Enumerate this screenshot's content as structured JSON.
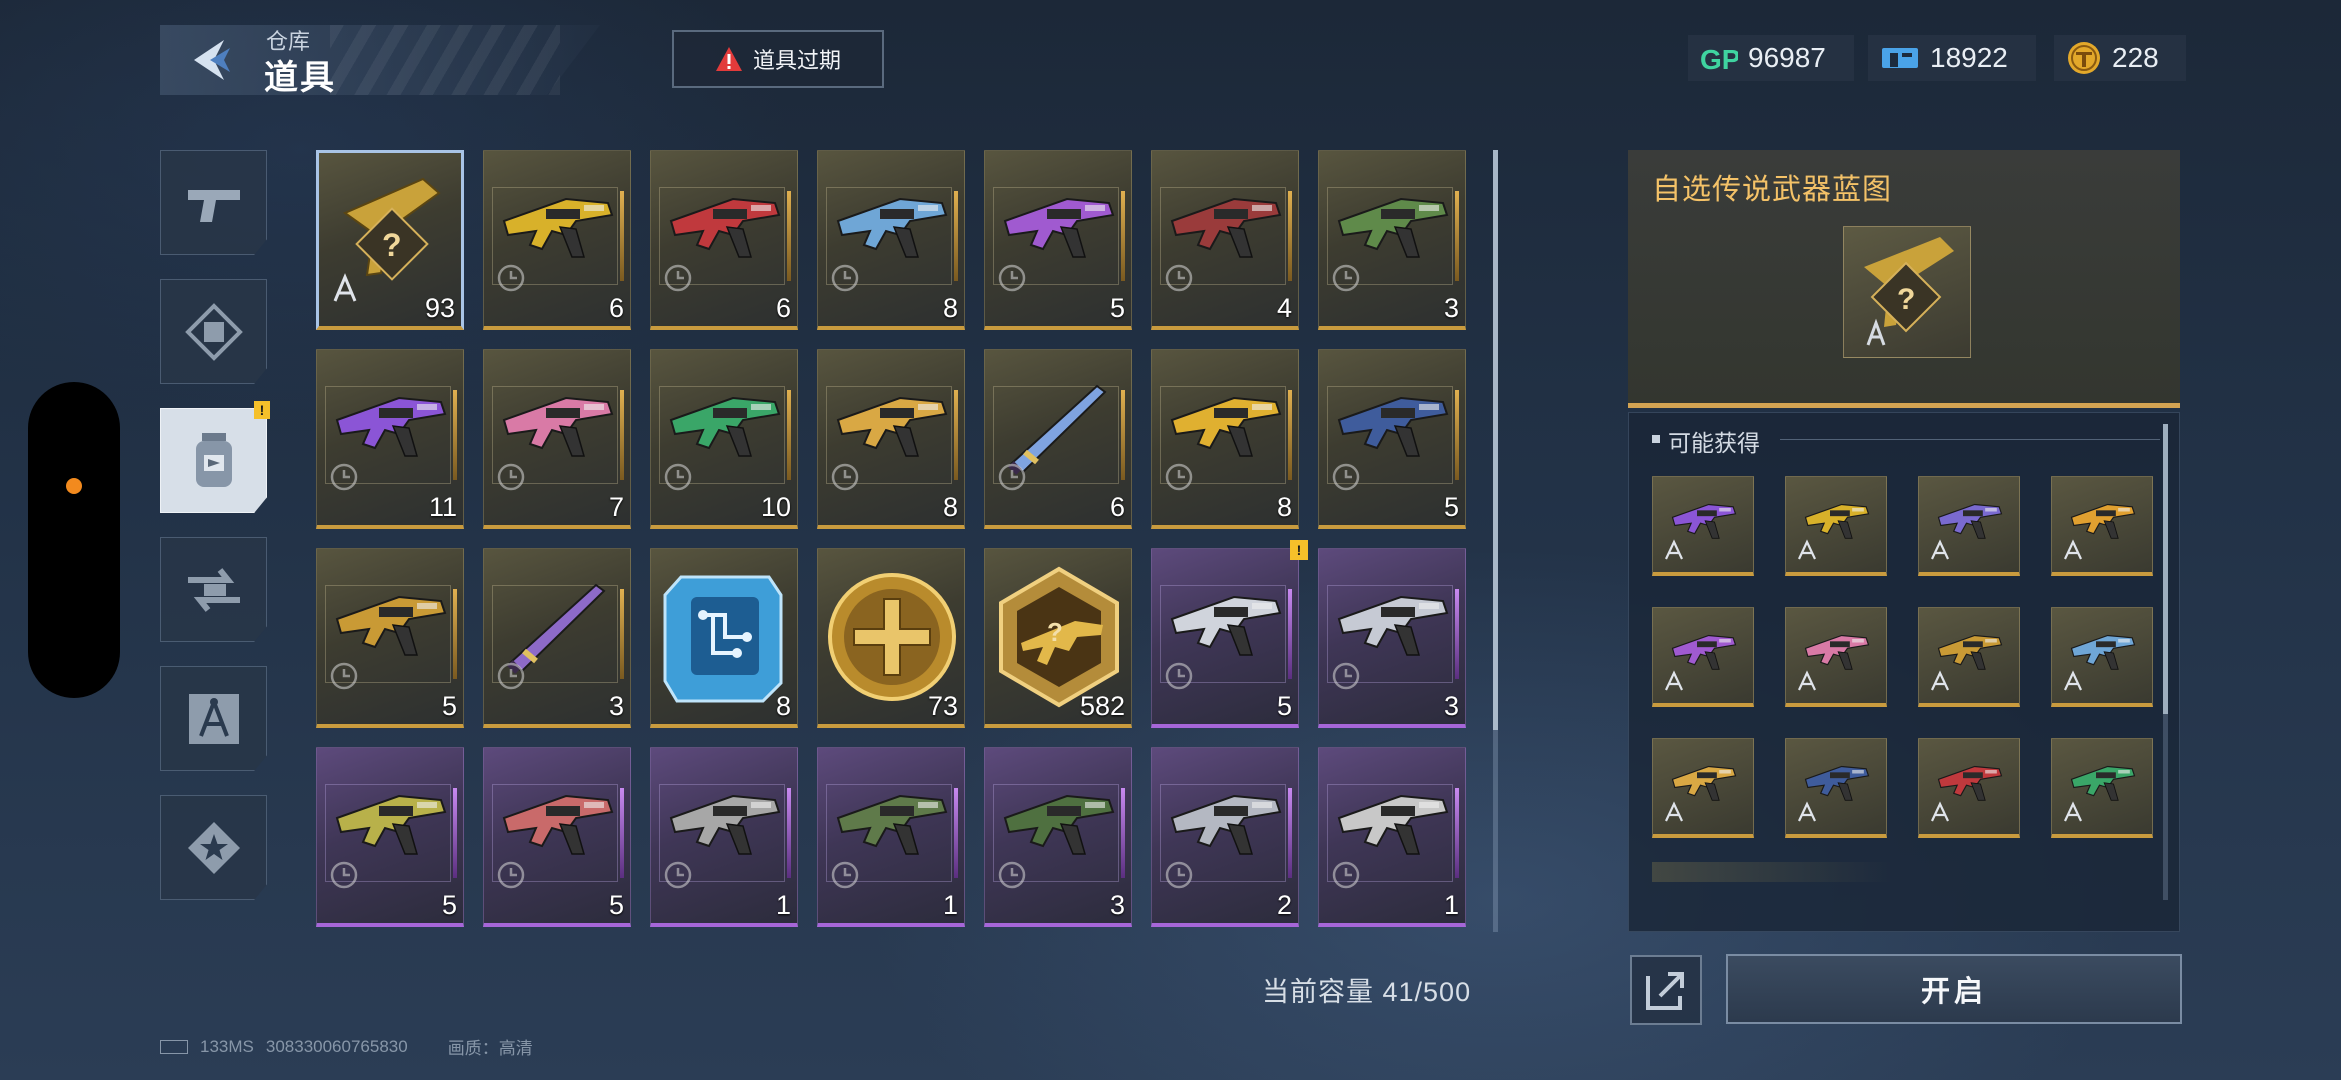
{
  "header": {
    "subtitle": "仓库",
    "title": "道具"
  },
  "alert": {
    "label": "道具过期"
  },
  "currencies": [
    {
      "name": "gp",
      "value": "96987"
    },
    {
      "name": "ticket",
      "value": "18922"
    },
    {
      "name": "coin",
      "value": "228"
    }
  ],
  "categories": [
    {
      "name": "weapons",
      "active": false
    },
    {
      "name": "skins",
      "active": false
    },
    {
      "name": "items",
      "active": true,
      "badge": "!"
    },
    {
      "name": "exchange",
      "active": false
    },
    {
      "name": "blueprints",
      "active": false
    },
    {
      "name": "badges",
      "active": false
    }
  ],
  "items": [
    {
      "qty": "93",
      "rarity": "gold",
      "kind": "blueprint"
    },
    {
      "qty": "6",
      "rarity": "gold",
      "kind": "gun",
      "c": "#d8b12a"
    },
    {
      "qty": "6",
      "rarity": "gold",
      "kind": "gun",
      "c": "#c0393d"
    },
    {
      "qty": "8",
      "rarity": "gold",
      "kind": "gun",
      "c": "#6fa6d6"
    },
    {
      "qty": "5",
      "rarity": "gold",
      "kind": "gun",
      "c": "#a05ad0"
    },
    {
      "qty": "4",
      "rarity": "gold",
      "kind": "gun",
      "c": "#9a3b3b"
    },
    {
      "qty": "3",
      "rarity": "gold",
      "kind": "gun",
      "c": "#5f8a4a"
    },
    {
      "qty": "11",
      "rarity": "gold",
      "kind": "gun",
      "c": "#8b55d6"
    },
    {
      "qty": "7",
      "rarity": "gold",
      "kind": "gun",
      "c": "#d97aa6"
    },
    {
      "qty": "10",
      "rarity": "gold",
      "kind": "gun",
      "c": "#3aa668"
    },
    {
      "qty": "8",
      "rarity": "gold",
      "kind": "gun",
      "c": "#d9a844"
    },
    {
      "qty": "6",
      "rarity": "gold",
      "kind": "blade",
      "c": "#7fa3e0"
    },
    {
      "qty": "8",
      "rarity": "gold",
      "kind": "gun",
      "c": "#e0b030"
    },
    {
      "qty": "5",
      "rarity": "gold",
      "kind": "gun",
      "c": "#3f5c9c"
    },
    {
      "qty": "5",
      "rarity": "gold",
      "kind": "gun",
      "c": "#c99a35"
    },
    {
      "qty": "3",
      "rarity": "gold",
      "kind": "blade",
      "c": "#8d6ac8"
    },
    {
      "qty": "8",
      "rarity": "gold",
      "kind": "chip"
    },
    {
      "qty": "73",
      "rarity": "gold",
      "kind": "medal"
    },
    {
      "qty": "582",
      "rarity": "gold",
      "kind": "hexbadge"
    },
    {
      "qty": "5",
      "rarity": "purple",
      "kind": "gun",
      "c": "#d0d4dc",
      "badge": true
    },
    {
      "qty": "3",
      "rarity": "purple",
      "kind": "gun",
      "c": "#c6cad4"
    },
    {
      "qty": "5",
      "rarity": "purple",
      "kind": "gun",
      "c": "#b8b14a"
    },
    {
      "qty": "5",
      "rarity": "purple",
      "kind": "gun",
      "c": "#c96a6a"
    },
    {
      "qty": "1",
      "rarity": "purple",
      "kind": "gun",
      "c": "#a7a7a7"
    },
    {
      "qty": "1",
      "rarity": "purple",
      "kind": "gun",
      "c": "#5f7a4a"
    },
    {
      "qty": "3",
      "rarity": "purple",
      "kind": "gun",
      "c": "#4f7040"
    },
    {
      "qty": "2",
      "rarity": "purple",
      "kind": "gun",
      "c": "#b4b8c2"
    },
    {
      "qty": "1",
      "rarity": "purple",
      "kind": "gun",
      "c": "#c8c8c8"
    }
  ],
  "capacity": {
    "label": "当前容量 41/500"
  },
  "detail": {
    "title": "自选传说武器蓝图",
    "section": "可能获得",
    "rewards": [
      {
        "c": "#8b55d6"
      },
      {
        "c": "#d8b12a"
      },
      {
        "c": "#7a6ad0"
      },
      {
        "c": "#e0a030"
      },
      {
        "c": "#a05ad0"
      },
      {
        "c": "#d97aa6"
      },
      {
        "c": "#c99a35"
      },
      {
        "c": "#6fa6d6"
      },
      {
        "c": "#d9a844"
      },
      {
        "c": "#3f5c9c"
      },
      {
        "c": "#c0393d"
      },
      {
        "c": "#3aa668"
      }
    ],
    "open_label": "开启"
  },
  "status": {
    "ping": "133MS",
    "id": "308330060765830",
    "quality": "画质：高清"
  },
  "colors": {
    "gold": "#c99b3e",
    "purple": "#a666d8",
    "accent": "#f4c268"
  }
}
